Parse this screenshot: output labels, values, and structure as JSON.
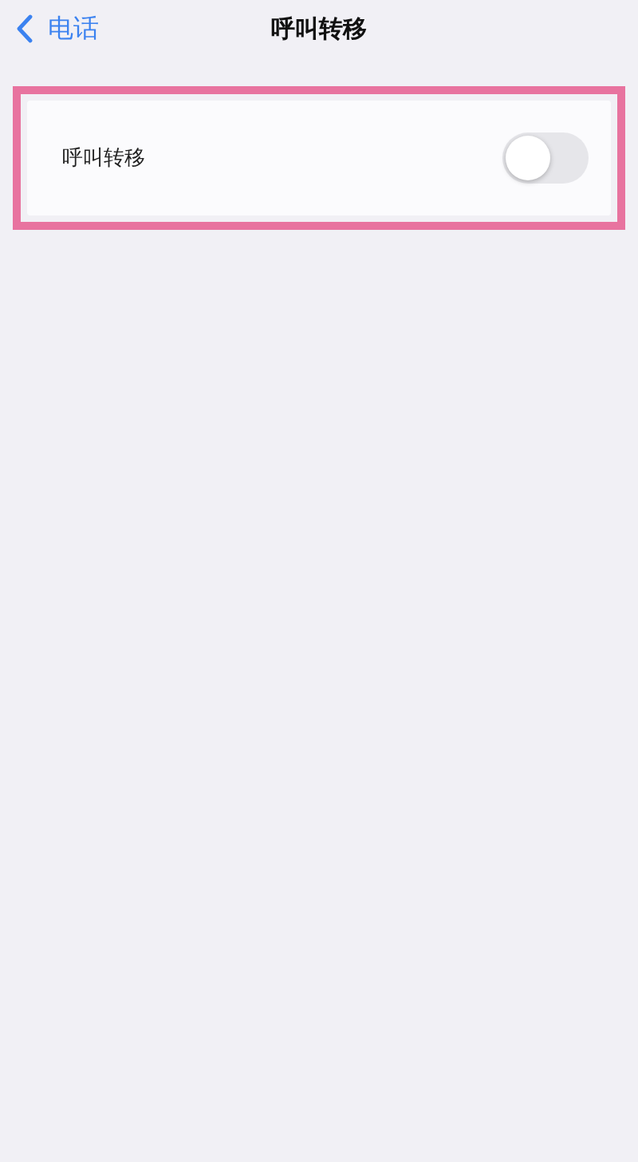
{
  "nav": {
    "back_label": "电话",
    "title": "呼叫转移"
  },
  "highlight": {
    "shown": true
  },
  "settings": [
    {
      "label": "呼叫转移",
      "kind": "toggle",
      "on": false
    }
  ]
}
